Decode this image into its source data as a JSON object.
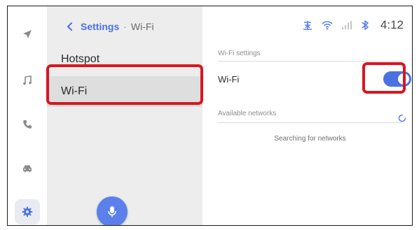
{
  "breadcrumb": {
    "parent": "Settings",
    "separator": "·",
    "current": "Wi-Fi"
  },
  "menu": {
    "items": [
      {
        "label": "Hotspot",
        "selected": false
      },
      {
        "label": "Wi-Fi",
        "selected": true
      }
    ]
  },
  "rail": {
    "icons": [
      "navigation-icon",
      "music-icon",
      "phone-icon",
      "car-icon",
      "settings-gear-icon"
    ],
    "active": "settings-gear-icon"
  },
  "status_bar": {
    "icons": [
      "antenna-icon",
      "wifi-signal-icon",
      "cellular-signal-icon",
      "bluetooth-icon"
    ],
    "time": "4:12"
  },
  "wifi_settings": {
    "section_label": "Wi-Fi settings",
    "wifi_label": "Wi-Fi",
    "wifi_enabled": true,
    "networks_label": "Available networks",
    "searching_text": "Searching for networks"
  },
  "colors": {
    "accent": "#4a72e0",
    "mic_button": "#5b80ec",
    "menu_background": "#ededed",
    "selected_item": "#dedede",
    "highlight": "#d8161f"
  }
}
